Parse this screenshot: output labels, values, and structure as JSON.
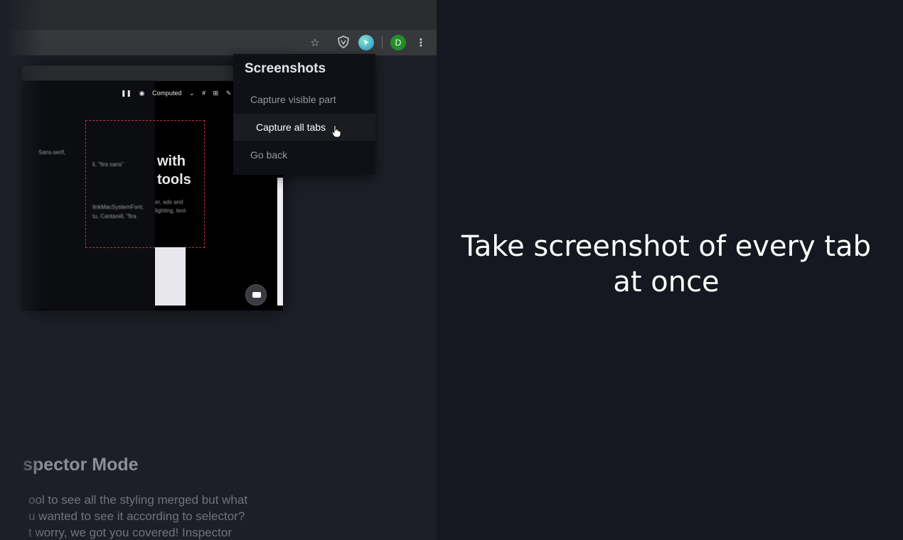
{
  "browser": {
    "avatar_letter": "D",
    "icons": [
      "star-icon",
      "shield-extension-icon",
      "screenshot-extension-icon",
      "profile-avatar",
      "more-vert-icon"
    ]
  },
  "preview": {
    "toolbar": {
      "pause": "❚❚",
      "mode": "Computed"
    },
    "headline_words": [
      "with",
      "tools"
    ],
    "blurred_lines": [
      "Sans-serif,",
      "ll, \"fira sans\"",
      "linkMacSystemFont,",
      "tu, Cantarell, \"fira",
      "er, ads and",
      "lighting, text-"
    ]
  },
  "popup": {
    "title": "Screenshots",
    "items": [
      {
        "label": "Capture visible part",
        "active": false
      },
      {
        "label": "Capture all tabs",
        "active": true
      },
      {
        "label": "Go back",
        "active": false
      }
    ]
  },
  "section": {
    "title": "spector Mode",
    "body_lines": [
      "ool to see all the styling merged but what",
      "u wanted to see it according to selector?",
      "t worry, we got you covered! Inspector"
    ]
  },
  "caption": {
    "line1": "Take screenshot of every tab",
    "line2": "at once"
  },
  "colors": {
    "background_left": "#1d1f28",
    "background_right": "#151820",
    "popup_bg": "#0f1116",
    "avatar": "#1f8f2a",
    "dash_accent": "#c0304a"
  }
}
